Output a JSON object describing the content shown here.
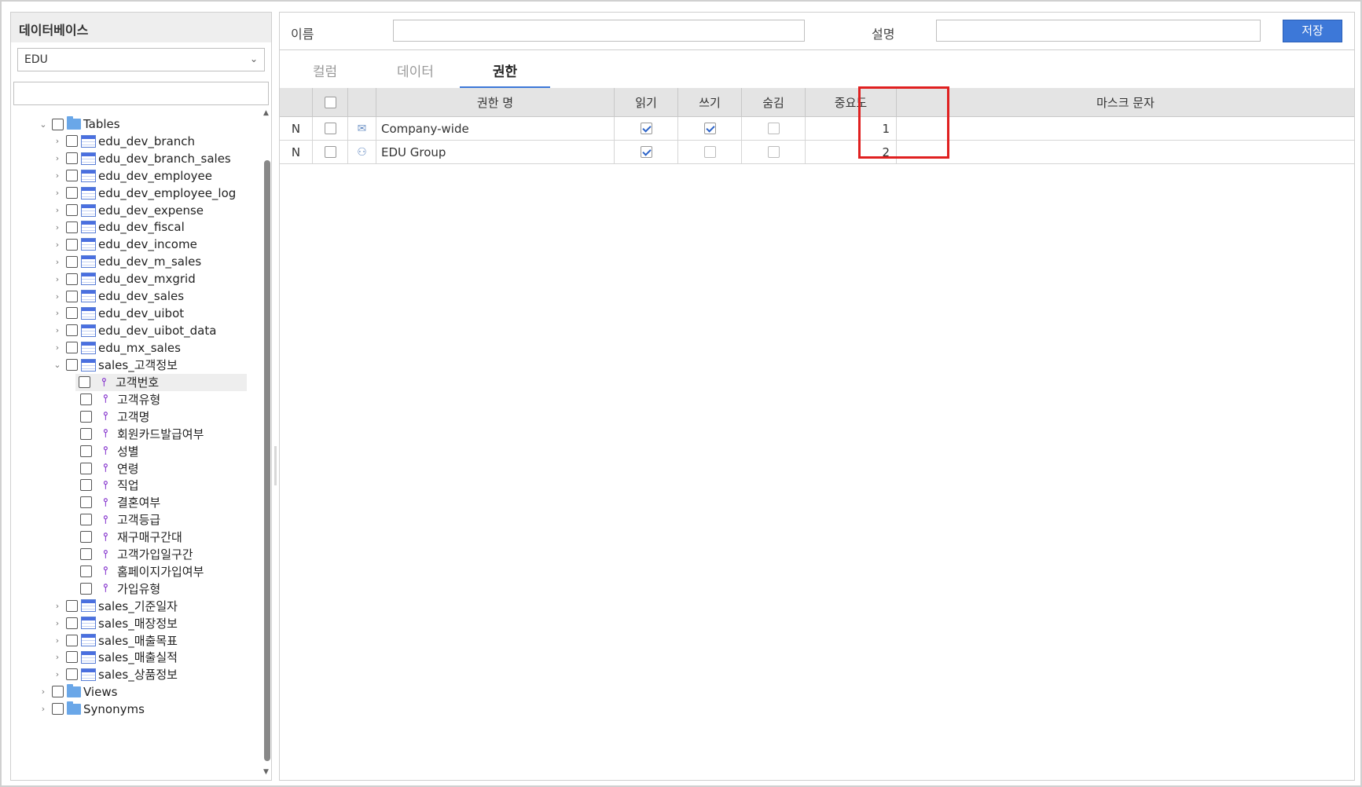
{
  "left_panel": {
    "title": "데이터베이스",
    "db_select": {
      "value": "EDU"
    },
    "search": {
      "value": "",
      "placeholder": ""
    },
    "tree": [
      {
        "level": 1,
        "type": "folder",
        "label": "Tables",
        "expanded": true,
        "selected": false
      },
      {
        "level": 2,
        "type": "table",
        "label": "edu_dev_branch",
        "expanded": false,
        "selected": false
      },
      {
        "level": 2,
        "type": "table",
        "label": "edu_dev_branch_sales",
        "expanded": false,
        "selected": false
      },
      {
        "level": 2,
        "type": "table",
        "label": "edu_dev_employee",
        "expanded": false,
        "selected": false
      },
      {
        "level": 2,
        "type": "table",
        "label": "edu_dev_employee_log",
        "expanded": false,
        "selected": false
      },
      {
        "level": 2,
        "type": "table",
        "label": "edu_dev_expense",
        "expanded": false,
        "selected": false
      },
      {
        "level": 2,
        "type": "table",
        "label": "edu_dev_fiscal",
        "expanded": false,
        "selected": false
      },
      {
        "level": 2,
        "type": "table",
        "label": "edu_dev_income",
        "expanded": false,
        "selected": false
      },
      {
        "level": 2,
        "type": "table",
        "label": "edu_dev_m_sales",
        "expanded": false,
        "selected": false
      },
      {
        "level": 2,
        "type": "table",
        "label": "edu_dev_mxgrid",
        "expanded": false,
        "selected": false
      },
      {
        "level": 2,
        "type": "table",
        "label": "edu_dev_sales",
        "expanded": false,
        "selected": false
      },
      {
        "level": 2,
        "type": "table",
        "label": "edu_dev_uibot",
        "expanded": false,
        "selected": false
      },
      {
        "level": 2,
        "type": "table",
        "label": "edu_dev_uibot_data",
        "expanded": false,
        "selected": false
      },
      {
        "level": 2,
        "type": "table",
        "label": "edu_mx_sales",
        "expanded": false,
        "selected": false
      },
      {
        "level": 2,
        "type": "table",
        "label": "sales_고객정보",
        "expanded": true,
        "selected": false
      },
      {
        "level": 3,
        "type": "column",
        "label": "고객번호",
        "selected": true
      },
      {
        "level": 3,
        "type": "column",
        "label": "고객유형",
        "selected": false
      },
      {
        "level": 3,
        "type": "column",
        "label": "고객명",
        "selected": false
      },
      {
        "level": 3,
        "type": "column",
        "label": "회원카드발급여부",
        "selected": false
      },
      {
        "level": 3,
        "type": "column",
        "label": "성별",
        "selected": false
      },
      {
        "level": 3,
        "type": "column",
        "label": "연령",
        "selected": false
      },
      {
        "level": 3,
        "type": "column",
        "label": "직업",
        "selected": false
      },
      {
        "level": 3,
        "type": "column",
        "label": "결혼여부",
        "selected": false
      },
      {
        "level": 3,
        "type": "column",
        "label": "고객등급",
        "selected": false
      },
      {
        "level": 3,
        "type": "column",
        "label": "재구매구간대",
        "selected": false
      },
      {
        "level": 3,
        "type": "column",
        "label": "고객가입일구간",
        "selected": false
      },
      {
        "level": 3,
        "type": "column",
        "label": "홈페이지가입여부",
        "selected": false
      },
      {
        "level": 3,
        "type": "column",
        "label": "가입유형",
        "selected": false
      },
      {
        "level": 2,
        "type": "table",
        "label": "sales_기준일자",
        "expanded": false,
        "selected": false
      },
      {
        "level": 2,
        "type": "table",
        "label": "sales_매장정보",
        "expanded": false,
        "selected": false
      },
      {
        "level": 2,
        "type": "table",
        "label": "sales_매출목표",
        "expanded": false,
        "selected": false
      },
      {
        "level": 2,
        "type": "table",
        "label": "sales_매출실적",
        "expanded": false,
        "selected": false
      },
      {
        "level": 2,
        "type": "table",
        "label": "sales_상품정보",
        "expanded": false,
        "selected": false
      },
      {
        "level": 1,
        "type": "folder",
        "label": "Views",
        "expanded": false,
        "selected": false
      },
      {
        "level": 1,
        "type": "folder",
        "label": "Synonyms",
        "expanded": false,
        "selected": false
      }
    ]
  },
  "form": {
    "name_label": "이름",
    "name_value": "",
    "desc_label": "설명",
    "desc_value": "",
    "save_label": "저장"
  },
  "tabs": [
    {
      "label": "컬럼",
      "active": false
    },
    {
      "label": "데이터",
      "active": false
    },
    {
      "label": "권한",
      "active": true
    }
  ],
  "grid": {
    "headers": {
      "name": "권한 명",
      "read": "읽기",
      "write": "쓰기",
      "hide": "숨김",
      "importance": "중요도",
      "mask": "마스크 문자"
    },
    "rows": [
      {
        "state": "N",
        "icon": "chat-user-icon",
        "name": "Company-wide",
        "read": true,
        "write": true,
        "hide": false,
        "importance": "1",
        "mask": ""
      },
      {
        "state": "N",
        "icon": "group-icon",
        "name": "EDU Group",
        "read": true,
        "write": false,
        "hide": false,
        "importance": "2",
        "mask": ""
      }
    ]
  },
  "colors": {
    "accent": "#3d78d8",
    "highlight_box": "#e02020",
    "column_icon": "#8a3ccf"
  }
}
